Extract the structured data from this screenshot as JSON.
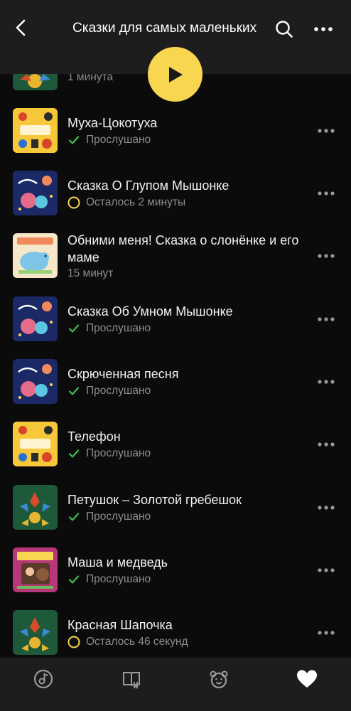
{
  "header": {
    "title": "Сказки для самых маленьких"
  },
  "items": [
    {
      "title": "",
      "status": "1 минута",
      "status_icon": "none",
      "cover": "green-folk"
    },
    {
      "title": "Муха-Цокотуха",
      "status": "Прослушано",
      "status_icon": "check-icon",
      "cover": "yellow-chukovsky"
    },
    {
      "title": "Сказка О Глупом Мышонке",
      "status": "Осталось 2 минуты",
      "status_icon": "progress-ring-icon",
      "cover": "navy-night"
    },
    {
      "title": "Обними меня! Сказка о слонёнке и его маме",
      "status": "15 минут",
      "status_icon": "none",
      "cover": "light-elephant"
    },
    {
      "title": "Сказка Об Умном Мышонке",
      "status": "Прослушано",
      "status_icon": "check-icon",
      "cover": "navy-night"
    },
    {
      "title": "Скрюченная песня",
      "status": "Прослушано",
      "status_icon": "check-icon",
      "cover": "navy-night"
    },
    {
      "title": "Телефон",
      "status": "Прослушано",
      "status_icon": "check-icon",
      "cover": "yellow-chukovsky"
    },
    {
      "title": "Петушок – Золотой гребешок",
      "status": "Прослушано",
      "status_icon": "check-icon",
      "cover": "green-folk"
    },
    {
      "title": "Маша и медведь",
      "status": "Прослушано",
      "status_icon": "check-icon",
      "cover": "pink-masha"
    },
    {
      "title": "Красная Шапочка",
      "status": "Осталось 46 секунд",
      "status_icon": "progress-ring-icon",
      "cover": "green-folk"
    }
  ],
  "tabs": [
    "music-tab-icon",
    "books-tab-icon",
    "kids-bear-tab-icon",
    "heart-tab-icon"
  ],
  "colors": {
    "accent": "#f9d64f",
    "check": "#3fbf4f",
    "background": "#0b0b0b",
    "bar": "#1d1d1d"
  }
}
